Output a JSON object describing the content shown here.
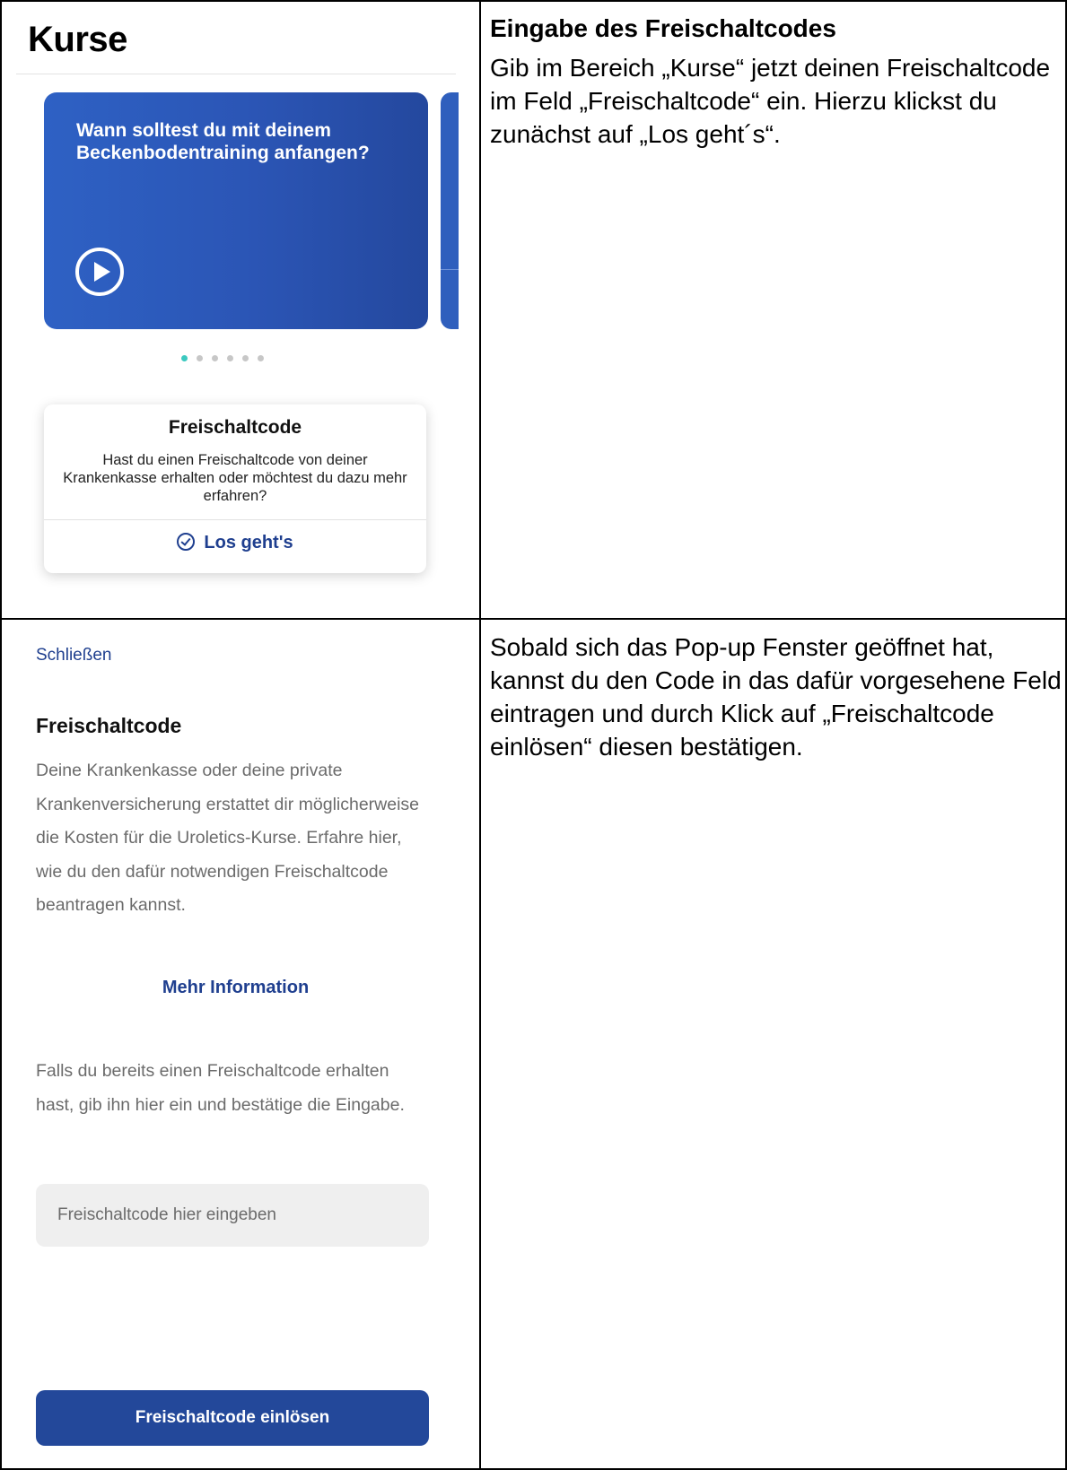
{
  "rows": [
    {
      "heading": "Eingabe des Freischaltcodes",
      "text": "Gib im Bereich „Kurse“ jetzt deinen Freischaltcode im Feld „Freischaltcode“ ein. Hierzu klickst du zunächst auf „Los geht´s“."
    },
    {
      "text": "Sobald sich das Pop-up Fenster geöffnet hat, kannst du den Code in das dafür vorgesehene Feld eintragen und durch Klick auf „Freischaltcode einlösen“ diesen bestätigen."
    }
  ],
  "kurse_screen": {
    "title": "Kurse",
    "video_card": {
      "question": "Wann solltest du mit deinem Beckenbodentraining anfangen?",
      "icon": "play-icon"
    },
    "carousel": {
      "total_dots": 6,
      "active_index": 0,
      "active_color": "#3cc9c0"
    },
    "code_card": {
      "title": "Freischaltcode",
      "description": "Hast du einen Freischaltcode von deiner Krankenkasse erhalten oder möchtest du dazu mehr erfahren?",
      "cta_label": "Los geht's",
      "cta_icon": "check-circle-icon"
    }
  },
  "popup_screen": {
    "close_label": "Schließen",
    "title": "Freischaltcode",
    "intro": "Deine Krankenkasse oder deine private Krankenversicherung erstattet dir möglicherweise die Kosten für die Uroletics-Kurse. Erfahre hier, wie du den dafür notwendigen Freischaltcode beantragen kannst.",
    "more_info_label": "Mehr Information",
    "instruction": "Falls du bereits einen Freischaltcode erhalten hast, gib ihn hier ein und bestätige die Eingabe.",
    "input_placeholder": "Freischaltcode hier eingeben",
    "input_value": "",
    "submit_label": "Freischaltcode einlösen"
  },
  "colors": {
    "brand_blue": "#23489a",
    "link_blue": "#1f3f8f",
    "card_gradient_start": "#2e61c4",
    "card_gradient_end": "#24489e"
  }
}
